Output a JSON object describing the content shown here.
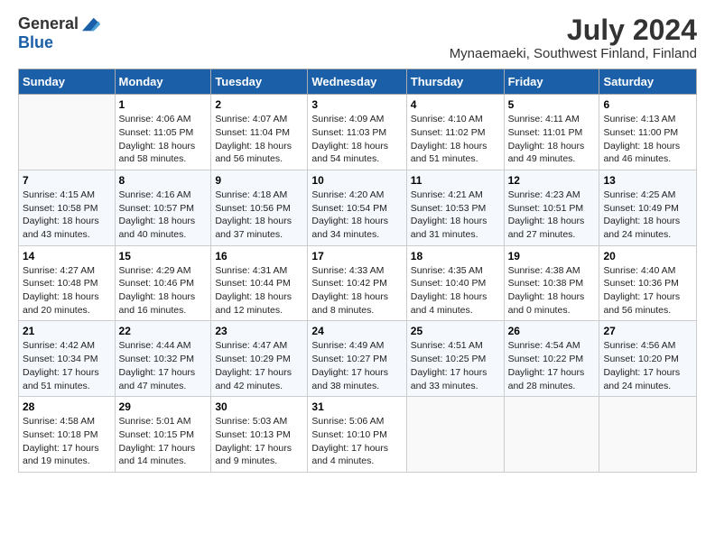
{
  "header": {
    "logo_general": "General",
    "logo_blue": "Blue",
    "month_title": "July 2024",
    "location": "Mynaemaeki, Southwest Finland, Finland"
  },
  "days_of_week": [
    "Sunday",
    "Monday",
    "Tuesday",
    "Wednesday",
    "Thursday",
    "Friday",
    "Saturday"
  ],
  "weeks": [
    [
      {
        "day": "",
        "sunrise": "",
        "sunset": "",
        "daylight": ""
      },
      {
        "day": "1",
        "sunrise": "Sunrise: 4:06 AM",
        "sunset": "Sunset: 11:05 PM",
        "daylight": "Daylight: 18 hours and 58 minutes."
      },
      {
        "day": "2",
        "sunrise": "Sunrise: 4:07 AM",
        "sunset": "Sunset: 11:04 PM",
        "daylight": "Daylight: 18 hours and 56 minutes."
      },
      {
        "day": "3",
        "sunrise": "Sunrise: 4:09 AM",
        "sunset": "Sunset: 11:03 PM",
        "daylight": "Daylight: 18 hours and 54 minutes."
      },
      {
        "day": "4",
        "sunrise": "Sunrise: 4:10 AM",
        "sunset": "Sunset: 11:02 PM",
        "daylight": "Daylight: 18 hours and 51 minutes."
      },
      {
        "day": "5",
        "sunrise": "Sunrise: 4:11 AM",
        "sunset": "Sunset: 11:01 PM",
        "daylight": "Daylight: 18 hours and 49 minutes."
      },
      {
        "day": "6",
        "sunrise": "Sunrise: 4:13 AM",
        "sunset": "Sunset: 11:00 PM",
        "daylight": "Daylight: 18 hours and 46 minutes."
      }
    ],
    [
      {
        "day": "7",
        "sunrise": "Sunrise: 4:15 AM",
        "sunset": "Sunset: 10:58 PM",
        "daylight": "Daylight: 18 hours and 43 minutes."
      },
      {
        "day": "8",
        "sunrise": "Sunrise: 4:16 AM",
        "sunset": "Sunset: 10:57 PM",
        "daylight": "Daylight: 18 hours and 40 minutes."
      },
      {
        "day": "9",
        "sunrise": "Sunrise: 4:18 AM",
        "sunset": "Sunset: 10:56 PM",
        "daylight": "Daylight: 18 hours and 37 minutes."
      },
      {
        "day": "10",
        "sunrise": "Sunrise: 4:20 AM",
        "sunset": "Sunset: 10:54 PM",
        "daylight": "Daylight: 18 hours and 34 minutes."
      },
      {
        "day": "11",
        "sunrise": "Sunrise: 4:21 AM",
        "sunset": "Sunset: 10:53 PM",
        "daylight": "Daylight: 18 hours and 31 minutes."
      },
      {
        "day": "12",
        "sunrise": "Sunrise: 4:23 AM",
        "sunset": "Sunset: 10:51 PM",
        "daylight": "Daylight: 18 hours and 27 minutes."
      },
      {
        "day": "13",
        "sunrise": "Sunrise: 4:25 AM",
        "sunset": "Sunset: 10:49 PM",
        "daylight": "Daylight: 18 hours and 24 minutes."
      }
    ],
    [
      {
        "day": "14",
        "sunrise": "Sunrise: 4:27 AM",
        "sunset": "Sunset: 10:48 PM",
        "daylight": "Daylight: 18 hours and 20 minutes."
      },
      {
        "day": "15",
        "sunrise": "Sunrise: 4:29 AM",
        "sunset": "Sunset: 10:46 PM",
        "daylight": "Daylight: 18 hours and 16 minutes."
      },
      {
        "day": "16",
        "sunrise": "Sunrise: 4:31 AM",
        "sunset": "Sunset: 10:44 PM",
        "daylight": "Daylight: 18 hours and 12 minutes."
      },
      {
        "day": "17",
        "sunrise": "Sunrise: 4:33 AM",
        "sunset": "Sunset: 10:42 PM",
        "daylight": "Daylight: 18 hours and 8 minutes."
      },
      {
        "day": "18",
        "sunrise": "Sunrise: 4:35 AM",
        "sunset": "Sunset: 10:40 PM",
        "daylight": "Daylight: 18 hours and 4 minutes."
      },
      {
        "day": "19",
        "sunrise": "Sunrise: 4:38 AM",
        "sunset": "Sunset: 10:38 PM",
        "daylight": "Daylight: 18 hours and 0 minutes."
      },
      {
        "day": "20",
        "sunrise": "Sunrise: 4:40 AM",
        "sunset": "Sunset: 10:36 PM",
        "daylight": "Daylight: 17 hours and 56 minutes."
      }
    ],
    [
      {
        "day": "21",
        "sunrise": "Sunrise: 4:42 AM",
        "sunset": "Sunset: 10:34 PM",
        "daylight": "Daylight: 17 hours and 51 minutes."
      },
      {
        "day": "22",
        "sunrise": "Sunrise: 4:44 AM",
        "sunset": "Sunset: 10:32 PM",
        "daylight": "Daylight: 17 hours and 47 minutes."
      },
      {
        "day": "23",
        "sunrise": "Sunrise: 4:47 AM",
        "sunset": "Sunset: 10:29 PM",
        "daylight": "Daylight: 17 hours and 42 minutes."
      },
      {
        "day": "24",
        "sunrise": "Sunrise: 4:49 AM",
        "sunset": "Sunset: 10:27 PM",
        "daylight": "Daylight: 17 hours and 38 minutes."
      },
      {
        "day": "25",
        "sunrise": "Sunrise: 4:51 AM",
        "sunset": "Sunset: 10:25 PM",
        "daylight": "Daylight: 17 hours and 33 minutes."
      },
      {
        "day": "26",
        "sunrise": "Sunrise: 4:54 AM",
        "sunset": "Sunset: 10:22 PM",
        "daylight": "Daylight: 17 hours and 28 minutes."
      },
      {
        "day": "27",
        "sunrise": "Sunrise: 4:56 AM",
        "sunset": "Sunset: 10:20 PM",
        "daylight": "Daylight: 17 hours and 24 minutes."
      }
    ],
    [
      {
        "day": "28",
        "sunrise": "Sunrise: 4:58 AM",
        "sunset": "Sunset: 10:18 PM",
        "daylight": "Daylight: 17 hours and 19 minutes."
      },
      {
        "day": "29",
        "sunrise": "Sunrise: 5:01 AM",
        "sunset": "Sunset: 10:15 PM",
        "daylight": "Daylight: 17 hours and 14 minutes."
      },
      {
        "day": "30",
        "sunrise": "Sunrise: 5:03 AM",
        "sunset": "Sunset: 10:13 PM",
        "daylight": "Daylight: 17 hours and 9 minutes."
      },
      {
        "day": "31",
        "sunrise": "Sunrise: 5:06 AM",
        "sunset": "Sunset: 10:10 PM",
        "daylight": "Daylight: 17 hours and 4 minutes."
      },
      {
        "day": "",
        "sunrise": "",
        "sunset": "",
        "daylight": ""
      },
      {
        "day": "",
        "sunrise": "",
        "sunset": "",
        "daylight": ""
      },
      {
        "day": "",
        "sunrise": "",
        "sunset": "",
        "daylight": ""
      }
    ]
  ]
}
